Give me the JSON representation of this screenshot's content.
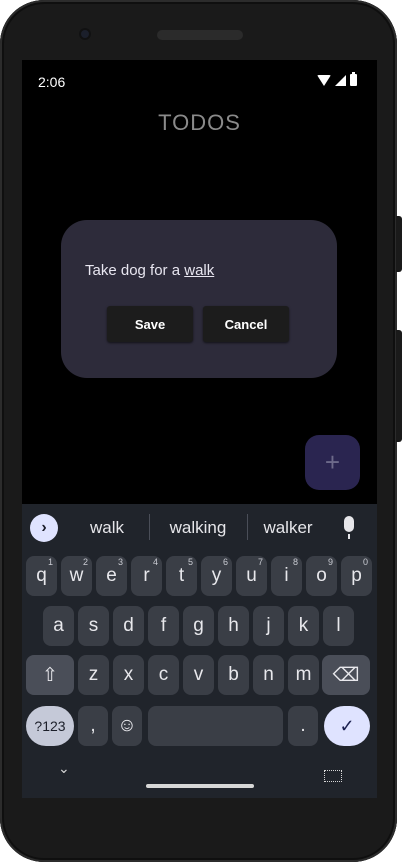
{
  "status_bar": {
    "time": "2:06"
  },
  "app": {
    "title": "TODOS"
  },
  "dialog": {
    "text_prefix": "Take dog for a ",
    "text_underlined": "walk",
    "save_label": "Save",
    "cancel_label": "Cancel"
  },
  "fab": {
    "label": "+"
  },
  "keyboard": {
    "suggestions": [
      "walk",
      "walking",
      "walker"
    ],
    "row1": [
      {
        "k": "q",
        "h": "1"
      },
      {
        "k": "w",
        "h": "2"
      },
      {
        "k": "e",
        "h": "3"
      },
      {
        "k": "r",
        "h": "4"
      },
      {
        "k": "t",
        "h": "5"
      },
      {
        "k": "y",
        "h": "6"
      },
      {
        "k": "u",
        "h": "7"
      },
      {
        "k": "i",
        "h": "8"
      },
      {
        "k": "o",
        "h": "9"
      },
      {
        "k": "p",
        "h": "0"
      }
    ],
    "row2": [
      "a",
      "s",
      "d",
      "f",
      "g",
      "h",
      "j",
      "k",
      "l"
    ],
    "row3": [
      "z",
      "x",
      "c",
      "v",
      "b",
      "n",
      "m"
    ],
    "symbols_label": "?123",
    "comma_label": ",",
    "period_label": ".",
    "emoji_label": "☺",
    "enter_icon": "check-icon",
    "shift_icon": "shift-icon",
    "backspace_icon": "backspace-icon"
  },
  "colors": {
    "dialog_bg": "#2d2b3a",
    "fab_bg": "#2a2550",
    "keyboard_bg": "#20242b",
    "accent": "#dfe3ff"
  }
}
